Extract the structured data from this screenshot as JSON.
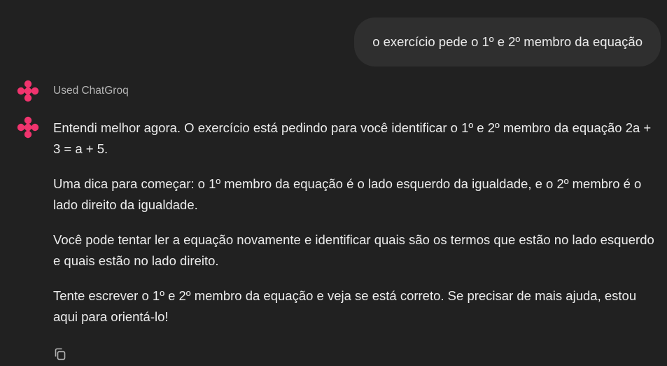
{
  "conversation": {
    "user_message": "o exercício pede o 1º e 2º membro da equação",
    "tool_status": "Used ChatGroq",
    "assistant_paragraphs": [
      "Entendi melhor agora. O exercício está pedindo para você identificar o 1º e 2º membro da equação 2a + 3 = a + 5.",
      "Uma dica para começar: o 1º membro da equação é o lado esquerdo da igualdade, e o 2º membro é o lado direito da igualdade.",
      "Você pode tentar ler a equação novamente e identificar quais são os termos que estão no lado esquerdo e quais estão no lado direito.",
      "Tente escrever o 1º e 2º membro da equação e veja se está correto. Se precisar de mais ajuda, estou aqui para orientá-lo!"
    ]
  },
  "icons": {
    "avatar": "assistant-logo-icon",
    "copy": "copy-icon"
  },
  "colors": {
    "background": "#212121",
    "user_bubble": "#2f2f2f",
    "text": "#ececec",
    "muted_text": "#b4b4b4",
    "brand_accent": "#f0346e"
  }
}
